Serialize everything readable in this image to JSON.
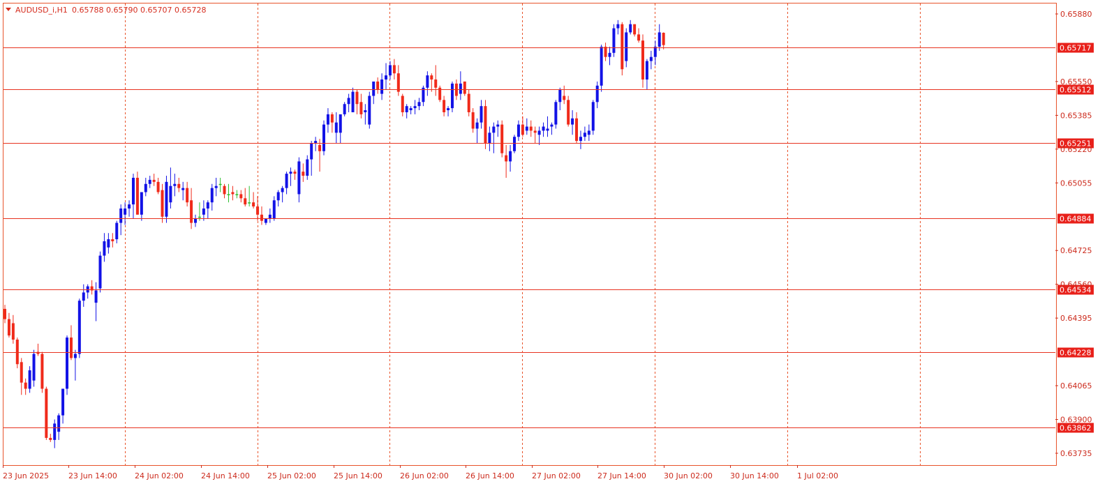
{
  "title": {
    "symbol_label": "AUDUSD_i,H1",
    "ohlc": "0.65788 0.65790 0.65707 0.65728"
  },
  "colors": {
    "background": "#ffffff",
    "grid": "#e8532a",
    "bull": "#1212e6",
    "bear": "#f02a1a",
    "doji": "#2fbf2f",
    "level_line": "#e8321f",
    "level_tag_bg": "#e8201a",
    "axis_text": "#cc2a1c"
  },
  "chart_data": {
    "type": "candlestick",
    "timeframe": "H1",
    "y_axis": {
      "range": [
        0.6367,
        0.6592
      ],
      "ticks": [
        "0.65880",
        "0.65550",
        "0.65385",
        "0.65220",
        "0.65055",
        "0.64725",
        "0.64560",
        "0.64395",
        "0.64065",
        "0.63900",
        "0.63735"
      ]
    },
    "x_axis": {
      "tick_labels": [
        "23 Jun 2025",
        "23 Jun 14:00",
        "24 Jun 02:00",
        "24 Jun 14:00",
        "25 Jun 02:00",
        "25 Jun 14:00",
        "26 Jun 02:00",
        "26 Jun 14:00",
        "27 Jun 02:00",
        "27 Jun 14:00",
        "30 Jun 02:00",
        "30 Jun 14:00",
        "1 Jul 02:00"
      ]
    },
    "horizontal_levels": [
      {
        "label": "0.65717",
        "value": 0.65717
      },
      {
        "label": "0.65512",
        "value": 0.65512
      },
      {
        "label": "0.65251",
        "value": 0.65251
      },
      {
        "label": "0.64884",
        "value": 0.64884
      },
      {
        "label": "0.64534",
        "value": 0.64534
      },
      {
        "label": "0.64228",
        "value": 0.64228
      },
      {
        "label": "0.63862",
        "value": 0.63862
      }
    ],
    "candles": [
      [
        0.6444,
        0.6446,
        0.6437,
        0.6439
      ],
      [
        0.6439,
        0.6442,
        0.643,
        0.6431
      ],
      [
        0.6437,
        0.6441,
        0.6427,
        0.6429
      ],
      [
        0.6429,
        0.643,
        0.6415,
        0.6417
      ],
      [
        0.6418,
        0.642,
        0.6402,
        0.6408
      ],
      [
        0.6408,
        0.641,
        0.6402,
        0.6405
      ],
      [
        0.6405,
        0.6416,
        0.6403,
        0.6414
      ],
      [
        0.6409,
        0.6424,
        0.6406,
        0.6422
      ],
      [
        0.6423,
        0.6427,
        0.6421,
        0.6422
      ],
      [
        0.6422,
        0.6423,
        0.6403,
        0.6405
      ],
      [
        0.6405,
        0.6406,
        0.638,
        0.6381
      ],
      [
        0.6381,
        0.6383,
        0.6379,
        0.638
      ],
      [
        0.638,
        0.639,
        0.6376,
        0.6388
      ],
      [
        0.6384,
        0.6393,
        0.638,
        0.6392
      ],
      [
        0.6392,
        0.6405,
        0.6388,
        0.6405
      ],
      [
        0.6405,
        0.6431,
        0.6402,
        0.643
      ],
      [
        0.643,
        0.6436,
        0.6419,
        0.642
      ],
      [
        0.642,
        0.6424,
        0.6409,
        0.6422
      ],
      [
        0.6422,
        0.6449,
        0.642,
        0.6448
      ],
      [
        0.6448,
        0.6456,
        0.6445,
        0.6452
      ],
      [
        0.6452,
        0.6456,
        0.6449,
        0.6455
      ],
      [
        0.6455,
        0.6458,
        0.6451,
        0.6453
      ],
      [
        0.6447,
        0.6457,
        0.6438,
        0.6453
      ],
      [
        0.6454,
        0.6472,
        0.6452,
        0.647
      ],
      [
        0.647,
        0.6481,
        0.6467,
        0.6477
      ],
      [
        0.6474,
        0.6481,
        0.6471,
        0.6478
      ],
      [
        0.6478,
        0.6481,
        0.6474,
        0.6477
      ],
      [
        0.6478,
        0.6487,
        0.6476,
        0.6486
      ],
      [
        0.6486,
        0.6495,
        0.648,
        0.6493
      ],
      [
        0.649,
        0.6496,
        0.6485,
        0.6493
      ],
      [
        0.6493,
        0.6497,
        0.6489,
        0.6495
      ],
      [
        0.6495,
        0.651,
        0.6488,
        0.6508
      ],
      [
        0.6508,
        0.6511,
        0.649,
        0.649
      ],
      [
        0.649,
        0.6501,
        0.6487,
        0.6501
      ],
      [
        0.6501,
        0.6508,
        0.6499,
        0.6505
      ],
      [
        0.6505,
        0.6509,
        0.6503,
        0.6507
      ],
      [
        0.6507,
        0.651,
        0.6504,
        0.6506
      ],
      [
        0.6506,
        0.6508,
        0.65,
        0.6501
      ],
      [
        0.6502,
        0.6505,
        0.6486,
        0.6489
      ],
      [
        0.6489,
        0.6509,
        0.6486,
        0.6506
      ],
      [
        0.6496,
        0.6513,
        0.6493,
        0.6504
      ],
      [
        0.6504,
        0.651,
        0.6499,
        0.6505
      ],
      [
        0.6505,
        0.6508,
        0.6501,
        0.6503
      ],
      [
        0.6502,
        0.6506,
        0.6497,
        0.6503
      ],
      [
        0.6503,
        0.6506,
        0.6494,
        0.6496
      ],
      [
        0.6497,
        0.6503,
        0.6483,
        0.6486
      ],
      [
        0.6486,
        0.649,
        0.6484,
        0.6488
      ],
      [
        0.6489,
        0.6496,
        0.6487,
        0.6489
      ],
      [
        0.649,
        0.6497,
        0.6487,
        0.6493
      ],
      [
        0.6493,
        0.6497,
        0.6488,
        0.6496
      ],
      [
        0.6496,
        0.6505,
        0.6492,
        0.6503
      ],
      [
        0.6503,
        0.6508,
        0.6499,
        0.6504
      ],
      [
        0.6505,
        0.6508,
        0.6501,
        0.6505
      ],
      [
        0.6504,
        0.6505,
        0.6498,
        0.65
      ],
      [
        0.65,
        0.6505,
        0.6496,
        0.65
      ],
      [
        0.6501,
        0.6504,
        0.6497,
        0.65
      ],
      [
        0.65,
        0.6502,
        0.6498,
        0.65
      ],
      [
        0.65,
        0.6502,
        0.6496,
        0.6498
      ],
      [
        0.6498,
        0.6503,
        0.6494,
        0.6495
      ],
      [
        0.6496,
        0.6504,
        0.6494,
        0.6496
      ],
      [
        0.6496,
        0.6501,
        0.6493,
        0.6494
      ],
      [
        0.6494,
        0.6499,
        0.6487,
        0.649
      ],
      [
        0.649,
        0.6494,
        0.6485,
        0.6487
      ],
      [
        0.6486,
        0.6488,
        0.6485,
        0.6488
      ],
      [
        0.6488,
        0.6493,
        0.6486,
        0.649
      ],
      [
        0.6488,
        0.6499,
        0.6487,
        0.6497
      ],
      [
        0.6497,
        0.6502,
        0.6494,
        0.6501
      ],
      [
        0.6501,
        0.6504,
        0.6496,
        0.6503
      ],
      [
        0.6503,
        0.6511,
        0.65,
        0.651
      ],
      [
        0.651,
        0.6513,
        0.6504,
        0.6511
      ],
      [
        0.6511,
        0.6512,
        0.6507,
        0.651
      ],
      [
        0.65,
        0.6518,
        0.6496,
        0.6516
      ],
      [
        0.6511,
        0.6515,
        0.6506,
        0.6509
      ],
      [
        0.6509,
        0.6519,
        0.6507,
        0.6517
      ],
      [
        0.6517,
        0.6526,
        0.6509,
        0.6525
      ],
      [
        0.6525,
        0.6528,
        0.6521,
        0.6526
      ],
      [
        0.6524,
        0.6527,
        0.6511,
        0.6521
      ],
      [
        0.6521,
        0.6536,
        0.6519,
        0.6534
      ],
      [
        0.6534,
        0.6542,
        0.653,
        0.6539
      ],
      [
        0.6539,
        0.654,
        0.653,
        0.6535
      ],
      [
        0.653,
        0.654,
        0.6525,
        0.6535
      ],
      [
        0.653,
        0.6538,
        0.6525,
        0.6539
      ],
      [
        0.6539,
        0.6545,
        0.6538,
        0.6544
      ],
      [
        0.6544,
        0.6549,
        0.654,
        0.6547
      ],
      [
        0.654,
        0.6552,
        0.654,
        0.655
      ],
      [
        0.655,
        0.6551,
        0.6539,
        0.6544
      ],
      [
        0.6545,
        0.6549,
        0.6537,
        0.6539
      ],
      [
        0.654,
        0.6544,
        0.6534,
        0.6541
      ],
      [
        0.6534,
        0.655,
        0.6532,
        0.6548
      ],
      [
        0.6548,
        0.6554,
        0.6544,
        0.6555
      ],
      [
        0.6555,
        0.6557,
        0.6549,
        0.6551
      ],
      [
        0.6549,
        0.6559,
        0.6546,
        0.6556
      ],
      [
        0.6556,
        0.6564,
        0.6551,
        0.6558
      ],
      [
        0.6558,
        0.6565,
        0.6556,
        0.6563
      ],
      [
        0.6563,
        0.6566,
        0.6556,
        0.6559
      ],
      [
        0.6559,
        0.6563,
        0.6548,
        0.655
      ],
      [
        0.6548,
        0.6549,
        0.6538,
        0.654
      ],
      [
        0.654,
        0.6544,
        0.6537,
        0.6543
      ],
      [
        0.6541,
        0.6543,
        0.6539,
        0.6542
      ],
      [
        0.6542,
        0.6546,
        0.6539,
        0.6543
      ],
      [
        0.6543,
        0.6547,
        0.6541,
        0.6545
      ],
      [
        0.6545,
        0.6553,
        0.6543,
        0.6552
      ],
      [
        0.6552,
        0.656,
        0.6548,
        0.6558
      ],
      [
        0.6558,
        0.6559,
        0.655,
        0.6556
      ],
      [
        0.6556,
        0.6563,
        0.6548,
        0.6552
      ],
      [
        0.6552,
        0.6553,
        0.6545,
        0.6546
      ],
      [
        0.6546,
        0.6548,
        0.6538,
        0.654
      ],
      [
        0.6541,
        0.6543,
        0.6538,
        0.6542
      ],
      [
        0.6542,
        0.6555,
        0.654,
        0.6554
      ],
      [
        0.6554,
        0.6556,
        0.6546,
        0.6548
      ],
      [
        0.6549,
        0.656,
        0.6546,
        0.6554
      ],
      [
        0.6555,
        0.6555,
        0.6548,
        0.6549
      ],
      [
        0.6549,
        0.6551,
        0.6538,
        0.654
      ],
      [
        0.654,
        0.6542,
        0.653,
        0.6532
      ],
      [
        0.6532,
        0.6537,
        0.6525,
        0.6535
      ],
      [
        0.6535,
        0.6546,
        0.6532,
        0.6543
      ],
      [
        0.6543,
        0.6546,
        0.6522,
        0.6525
      ],
      [
        0.6525,
        0.6533,
        0.6521,
        0.653
      ],
      [
        0.653,
        0.6535,
        0.652,
        0.6533
      ],
      [
        0.6533,
        0.6536,
        0.6528,
        0.6534
      ],
      [
        0.6534,
        0.6536,
        0.6518,
        0.652
      ],
      [
        0.6519,
        0.6524,
        0.6508,
        0.6516
      ],
      [
        0.6516,
        0.6524,
        0.6511,
        0.6521
      ],
      [
        0.6521,
        0.6529,
        0.652,
        0.6528
      ],
      [
        0.6528,
        0.6536,
        0.6526,
        0.6534
      ],
      [
        0.6534,
        0.6538,
        0.6528,
        0.6529
      ],
      [
        0.6531,
        0.6537,
        0.6529,
        0.6533
      ],
      [
        0.6533,
        0.6536,
        0.6528,
        0.6531
      ],
      [
        0.6531,
        0.6533,
        0.6525,
        0.653
      ],
      [
        0.6529,
        0.6533,
        0.6524,
        0.6531
      ],
      [
        0.6531,
        0.6535,
        0.6528,
        0.6533
      ],
      [
        0.6531,
        0.6538,
        0.6528,
        0.6532
      ],
      [
        0.6533,
        0.6535,
        0.6529,
        0.6534
      ],
      [
        0.6534,
        0.6546,
        0.6532,
        0.6545
      ],
      [
        0.6545,
        0.6552,
        0.6541,
        0.6551
      ],
      [
        0.6548,
        0.6553,
        0.6544,
        0.6546
      ],
      [
        0.6546,
        0.6548,
        0.6533,
        0.6534
      ],
      [
        0.6534,
        0.6541,
        0.6529,
        0.6537
      ],
      [
        0.6537,
        0.654,
        0.6525,
        0.6526
      ],
      [
        0.6526,
        0.6531,
        0.6522,
        0.6528
      ],
      [
        0.6528,
        0.6533,
        0.6526,
        0.653
      ],
      [
        0.6529,
        0.6534,
        0.6526,
        0.6531
      ],
      [
        0.6531,
        0.6546,
        0.6529,
        0.6545
      ],
      [
        0.6545,
        0.6555,
        0.6542,
        0.6553
      ],
      [
        0.6553,
        0.6573,
        0.655,
        0.6572
      ],
      [
        0.6572,
        0.6574,
        0.6565,
        0.6567
      ],
      [
        0.6567,
        0.6572,
        0.6563,
        0.6569
      ],
      [
        0.6569,
        0.6583,
        0.6567,
        0.6581
      ],
      [
        0.6581,
        0.6585,
        0.6578,
        0.6583
      ],
      [
        0.6583,
        0.6584,
        0.6558,
        0.6561
      ],
      [
        0.6565,
        0.6581,
        0.6562,
        0.6579
      ],
      [
        0.6579,
        0.6585,
        0.6578,
        0.6583
      ],
      [
        0.6583,
        0.6583,
        0.6577,
        0.6578
      ],
      [
        0.6578,
        0.6581,
        0.6574,
        0.6575
      ],
      [
        0.6575,
        0.6578,
        0.6552,
        0.6556
      ],
      [
        0.6556,
        0.6566,
        0.6551,
        0.6565
      ],
      [
        0.6565,
        0.657,
        0.6561,
        0.6567
      ],
      [
        0.6567,
        0.6575,
        0.6563,
        0.6572
      ],
      [
        0.6572,
        0.6583,
        0.657,
        0.6579
      ],
      [
        0.65788,
        0.6579,
        0.65707,
        0.65728
      ]
    ]
  }
}
